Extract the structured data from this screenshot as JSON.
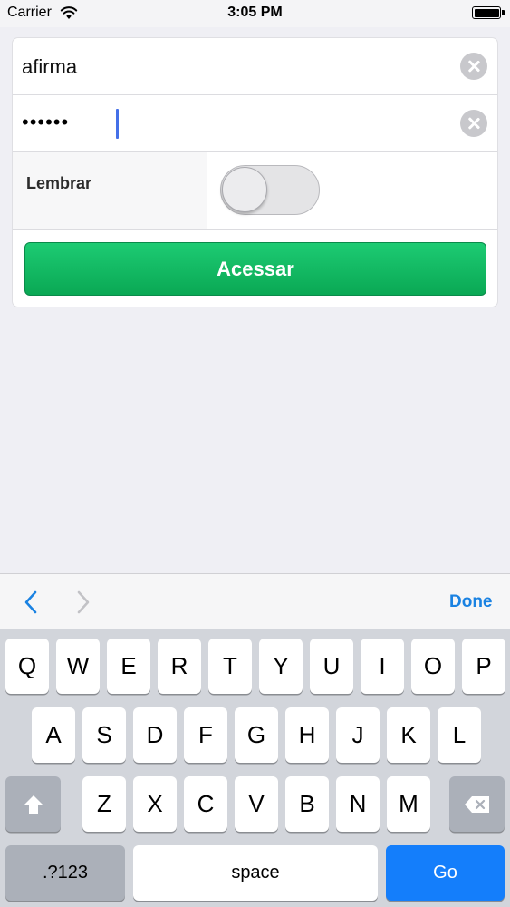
{
  "status_bar": {
    "carrier": "Carrier",
    "time": "3:05 PM",
    "icons": [
      "wifi-icon",
      "battery-icon"
    ]
  },
  "login_form": {
    "username": {
      "value": "afirma"
    },
    "password": {
      "masked_value": "••••••"
    },
    "remember": {
      "label": "Lembrar",
      "on": false
    },
    "submit_label": "Acessar"
  },
  "toolbar": {
    "done_label": "Done",
    "icons": [
      "chevron-left-icon",
      "chevron-right-icon"
    ]
  },
  "keyboard": {
    "row1": [
      "Q",
      "W",
      "E",
      "R",
      "T",
      "Y",
      "U",
      "I",
      "O",
      "P"
    ],
    "row2": [
      "A",
      "S",
      "D",
      "F",
      "G",
      "H",
      "J",
      "K",
      "L"
    ],
    "row3": [
      "Z",
      "X",
      "C",
      "V",
      "B",
      "N",
      "M"
    ],
    "numbers_label": ".?123",
    "space_label": "space",
    "go_label": "Go",
    "icons": [
      "shift-icon",
      "backspace-icon"
    ]
  },
  "colors": {
    "background": "#efeff4",
    "accent_button": "#0aa854",
    "go_key": "#147efb",
    "link_blue": "#1a82e2"
  }
}
